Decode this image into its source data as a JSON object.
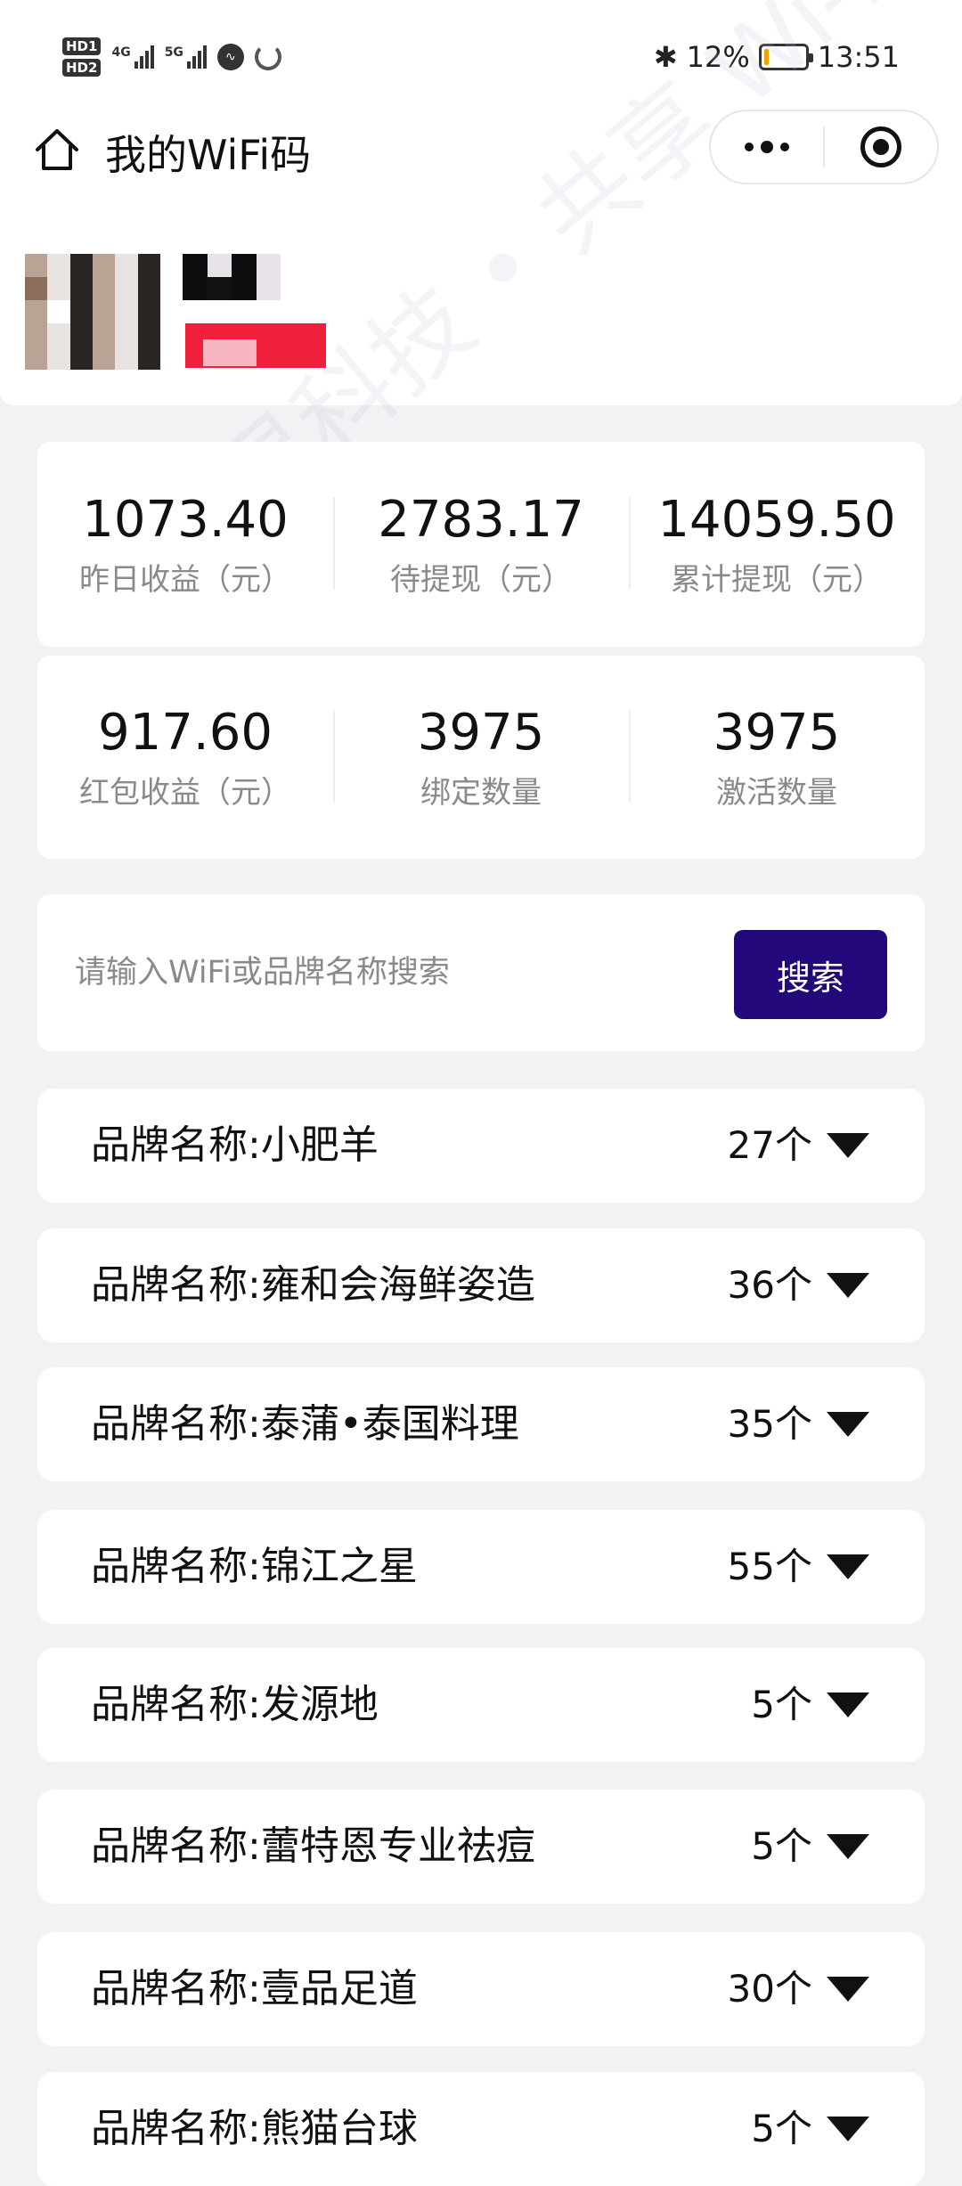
{
  "status_bar": {
    "hd1": "HD",
    "hd1_sub": "1",
    "hd2": "HD",
    "hd2_sub": "2",
    "net1": "4G",
    "net2": "5G",
    "battery_percent": "12%",
    "time": "13:51",
    "battery_level": 0.12,
    "battery_color": "#f2a100"
  },
  "nav": {
    "title": "我的WiFi码",
    "home_icon": "home-icon",
    "more_icon": "more-dots-icon",
    "close_icon": "target-circle-icon"
  },
  "stats": [
    {
      "value": "1073.40",
      "label": "昨日收益（元）"
    },
    {
      "value": "2783.17",
      "label": "待提现（元）"
    },
    {
      "value": "14059.50",
      "label": "累计提现（元）"
    },
    {
      "value": "917.60",
      "label": "红包收益（元）"
    },
    {
      "value": "3975",
      "label": "绑定数量"
    },
    {
      "value": "3975",
      "label": "激活数量"
    }
  ],
  "search": {
    "placeholder": "请输入WiFi或品牌名称搜索",
    "value": "",
    "button_label": "搜索",
    "button_color": "#22087a"
  },
  "brands": [
    {
      "name": "品牌名称:小肥羊",
      "count": "27个"
    },
    {
      "name": "品牌名称:雍和会海鲜姿造",
      "count": "36个"
    },
    {
      "name": "品牌名称:泰蒲•泰国料理",
      "count": "35个"
    },
    {
      "name": "品牌名称:锦江之星",
      "count": "55个"
    },
    {
      "name": "品牌名称:发源地",
      "count": "5个"
    },
    {
      "name": "品牌名称:蕾特恩专业祛痘",
      "count": "5个"
    },
    {
      "name": "品牌名称:壹品足道",
      "count": "30个"
    },
    {
      "name": "品牌名称:熊猫台球",
      "count": "5个"
    }
  ],
  "watermark": "鲸灵科技 • 共享 Wi-Fi"
}
